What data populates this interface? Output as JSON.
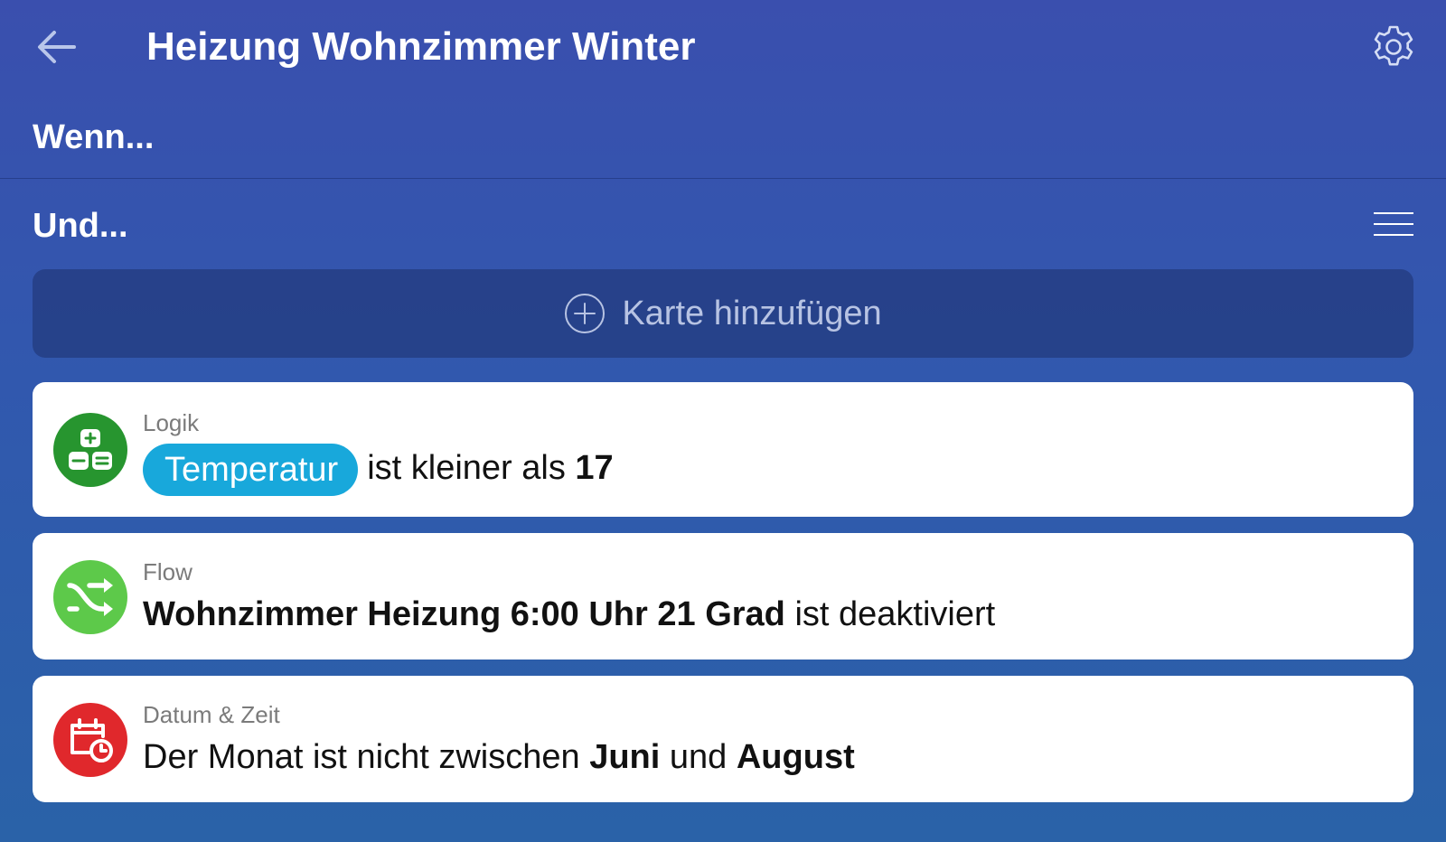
{
  "header": {
    "title": "Heizung Wohnzimmer Winter",
    "back_icon": "arrow-left-icon",
    "settings_icon": "gear-icon"
  },
  "sections": {
    "when_label": "Wenn...",
    "and_label": "Und..."
  },
  "add_card": {
    "label": "Karte hinzufügen",
    "icon": "plus-circle-icon"
  },
  "cards": [
    {
      "category": "Logik",
      "icon": "logic-calculator-icon",
      "icon_color": "#27952f",
      "token": "Temperatur",
      "text_middle": "ist kleiner als",
      "value": "17"
    },
    {
      "category": "Flow",
      "icon": "shuffle-flow-icon",
      "icon_color": "#5dc94a",
      "flow_name": "Wohnzimmer Heizung 6:00 Uhr 21 Grad",
      "text_after": "ist deaktiviert"
    },
    {
      "category": "Datum & Zeit",
      "icon": "calendar-clock-icon",
      "icon_color": "#e0282c",
      "text_before": "Der Monat ist nicht zwischen",
      "month_from": "Juni",
      "text_between": "und",
      "month_to": "August"
    }
  ],
  "colors": {
    "background_top": "#3a4fae",
    "background_bottom": "#2a62a8",
    "token_background": "#18a8db"
  }
}
